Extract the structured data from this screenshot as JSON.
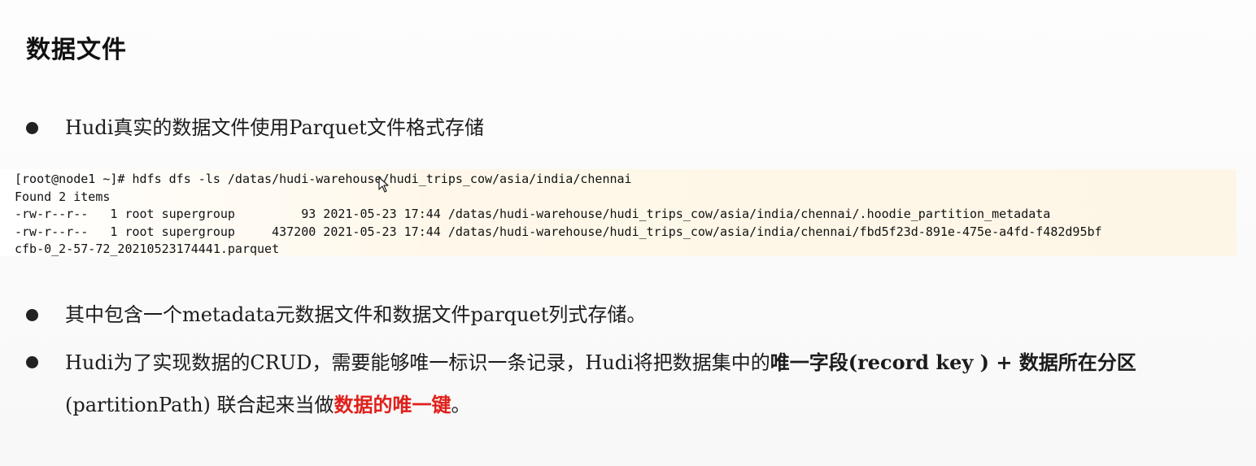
{
  "slide": {
    "title": "数据文件",
    "bullets": [
      {
        "text": "Hudi真实的数据文件使用Parquet文件格式存储"
      },
      {
        "text": "其中包含一个metadata元数据文件和数据文件parquet列式存储。"
      },
      {
        "part1": "Hudi为了实现数据的CRUD，需要能够唯一标识一条记录，Hudi将把数据集中的",
        "part2_bold": "唯一字段(record key ) + 数据所在分区",
        "part3": " (partitionPath) 联合起来当做",
        "part4_red": "数据的唯一键",
        "part5": "。"
      }
    ]
  },
  "terminal": {
    "lines": [
      "[root@node1 ~]# hdfs dfs -ls /datas/hudi-warehouse/hudi_trips_cow/asia/india/chennai",
      "Found 2 items",
      "-rw-r--r--   1 root supergroup         93 2021-05-23 17:44 /datas/hudi-warehouse/hudi_trips_cow/asia/india/chennai/.hoodie_partition_metadata",
      "-rw-r--r--   1 root supergroup     437200 2021-05-23 17:44 /datas/hudi-warehouse/hudi_trips_cow/asia/india/chennai/fbd5f23d-891e-475e-a4fd-f482d95bf",
      "cfb-0_2-57-72_20210523174441.parquet"
    ]
  },
  "colors": {
    "highlight_red": "#e0201a",
    "terminal_bg": "#fdf6e6"
  },
  "icons": {
    "cursor": "mouse-pointer-icon",
    "bullet": "bullet-dot-icon"
  }
}
